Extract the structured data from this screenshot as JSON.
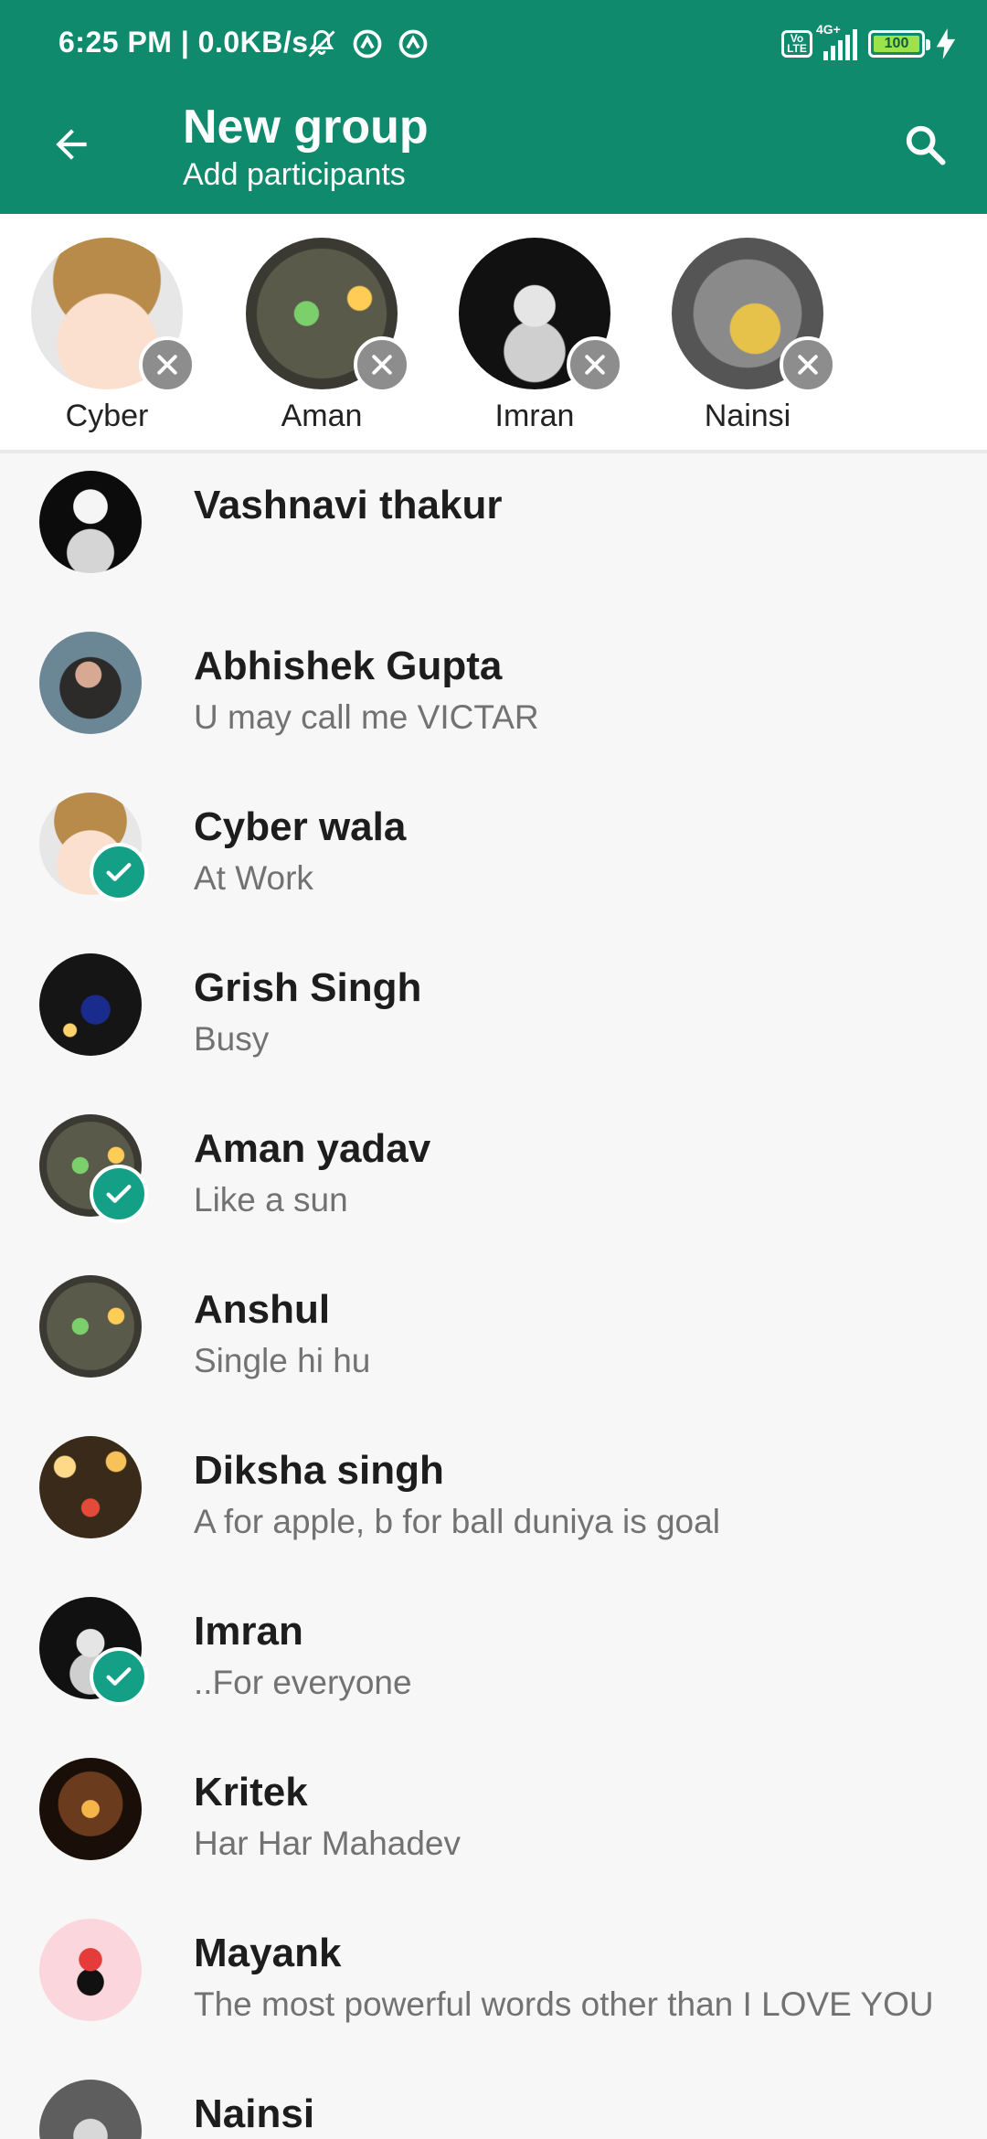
{
  "status_bar": {
    "time": "6:25 PM | 0.0KB/s",
    "network": "4G+",
    "battery": "100",
    "icons": [
      "mute-icon",
      "sync-icon",
      "sync-icon",
      "volte-icon",
      "signal-icon",
      "battery-icon",
      "charging-icon"
    ]
  },
  "header": {
    "title": "New group",
    "subtitle": "Add participants"
  },
  "selected": [
    {
      "name": "Cyber"
    },
    {
      "name": "Aman"
    },
    {
      "name": "Imran"
    },
    {
      "name": "Nainsi"
    }
  ],
  "contacts": [
    {
      "name": "Vashnavi thakur",
      "status": "",
      "selected": false
    },
    {
      "name": "Abhishek Gupta",
      "status": "U may call me VICTAR",
      "selected": false
    },
    {
      "name": "Cyber wala",
      "status": "At Work",
      "selected": true
    },
    {
      "name": "Grish Singh",
      "status": "Busy",
      "selected": false
    },
    {
      "name": "Aman yadav",
      "status": "Like a sun",
      "selected": true
    },
    {
      "name": "Anshul",
      "status": "Single hi hu",
      "selected": false
    },
    {
      "name": "Diksha singh",
      "status": "A for apple, b for ball duniya is goal",
      "selected": false
    },
    {
      "name": "Imran",
      "status": "..For everyone",
      "selected": true
    },
    {
      "name": "Kritek",
      "status": "Har Har Mahadev",
      "selected": false
    },
    {
      "name": "Mayank",
      "status": "The most powerful words other than I LOVE YOU",
      "selected": false
    },
    {
      "name": "Nainsi",
      "status": "",
      "selected": true
    }
  ],
  "colors": {
    "accent": "#0f8a6d",
    "check": "#13a087"
  }
}
